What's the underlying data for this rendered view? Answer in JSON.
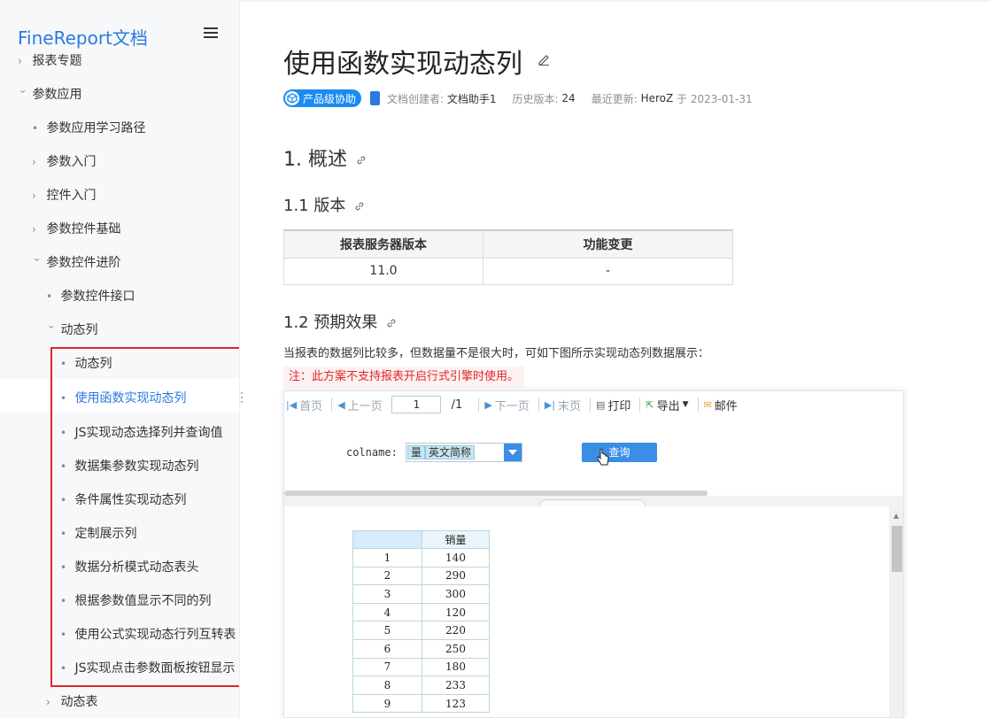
{
  "sidebar": {
    "brand": "FineReport文档",
    "items": [
      {
        "label": "报表专题",
        "mark": "›"
      },
      {
        "label": "参数应用",
        "mark": "›"
      },
      {
        "label": "参数应用学习路径",
        "mark": "•"
      },
      {
        "label": "参数入门",
        "mark": "›"
      },
      {
        "label": "控件入门",
        "mark": "›"
      },
      {
        "label": "参数控件基础",
        "mark": "›"
      },
      {
        "label": "参数控件进阶",
        "mark": "›"
      },
      {
        "label": "参数控件接口",
        "mark": "•"
      },
      {
        "label": "动态列",
        "mark": "›"
      },
      {
        "label": "动态列",
        "mark": "•"
      },
      {
        "label": "使用函数实现动态列",
        "mark": "•"
      },
      {
        "label": "JS实现动态选择列并查询值",
        "mark": "•"
      },
      {
        "label": "数据集参数实现动态列",
        "mark": "•"
      },
      {
        "label": "条件属性实现动态列",
        "mark": "•"
      },
      {
        "label": "定制展示列",
        "mark": "•"
      },
      {
        "label": "数据分析模式动态表头",
        "mark": "•"
      },
      {
        "label": "根据参数值显示不同的列",
        "mark": "•"
      },
      {
        "label": "使用公式实现动态行列互转表",
        "mark": "•"
      },
      {
        "label": "JS实现点击参数面板按钮显示",
        "mark": "•"
      },
      {
        "label": "动态表",
        "mark": "›"
      }
    ]
  },
  "page": {
    "title": "使用函数实现动态列",
    "meta": {
      "badge": "产品级协助",
      "creator_label": "文档创建者:",
      "creator": "文档助手1",
      "history_label": "历史版本:",
      "history": "24",
      "updated_label": "最近更新:",
      "updated_by": "HeroZ",
      "updated_at": "于 2023-01-31"
    },
    "sections": {
      "s1": "1. 概述",
      "s1_1": "1.1 版本",
      "s1_2": "1.2 预期效果"
    },
    "version_table": {
      "headers": [
        "报表服务器版本",
        "功能变更"
      ],
      "row": [
        "11.0",
        "-"
      ]
    },
    "paragraph": "当报表的数据列比较多，但数据量不是很大时，可如下图所示实现动态列数据展示：",
    "note": "注：此方案不支持报表开启行式引擎时使用。"
  },
  "screenshot": {
    "toolbar": {
      "first": "首页",
      "prev": "上一页",
      "page_value": "1",
      "page_total": "/1",
      "next": "下一页",
      "last": "末页",
      "print": "打印",
      "export": "导出",
      "mail": "邮件"
    },
    "param": {
      "colname_label": "colname:",
      "chip1": "量",
      "chip2": "英文简称",
      "query": "查询"
    },
    "table": {
      "header": "销量",
      "rows": [
        [
          "1",
          "140"
        ],
        [
          "2",
          "290"
        ],
        [
          "3",
          "300"
        ],
        [
          "4",
          "120"
        ],
        [
          "5",
          "220"
        ],
        [
          "6",
          "250"
        ],
        [
          "7",
          "180"
        ],
        [
          "8",
          "233"
        ],
        [
          "9",
          "123"
        ]
      ]
    }
  }
}
